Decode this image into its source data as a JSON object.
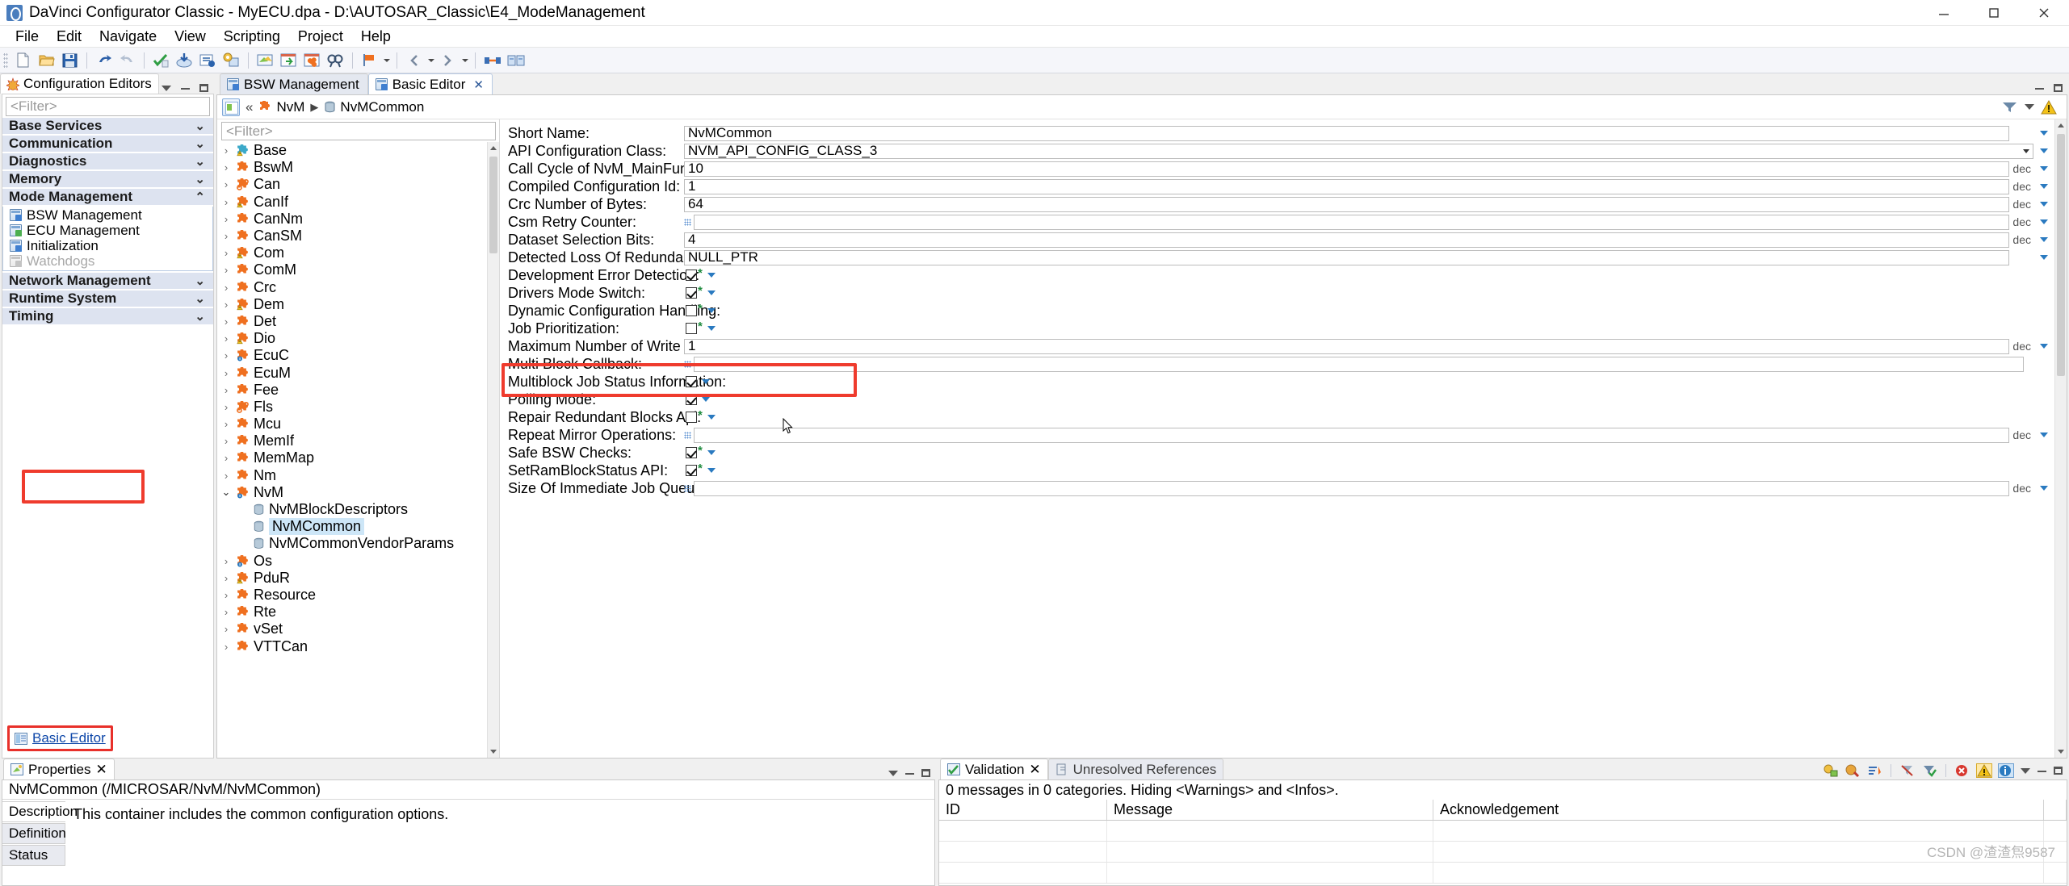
{
  "window": {
    "title": "DaVinci Configurator Classic - MyECU.dpa - D:\\AUTOSAR_Classic\\E4_ModeManagement",
    "app_icon": "davinci-icon",
    "minimize": "–",
    "maximize": "❑",
    "close": "✕"
  },
  "menubar": [
    "File",
    "Edit",
    "Navigate",
    "View",
    "Scripting",
    "Project",
    "Help"
  ],
  "toolbar": {
    "groups": [
      [
        "new-file-icon",
        "open-folder-icon",
        "save-icon"
      ],
      [
        "undo-icon",
        "redo-icon"
      ],
      [
        "validate-icon",
        "generate-icon",
        "report-icon",
        "settings-window-icon"
      ],
      [
        "editor-icon",
        "import-icon",
        "module-icon",
        "find-icon"
      ]
    ]
  },
  "left_panel": {
    "tab_label": "Configuration Editors",
    "tab_icon": "star-icon",
    "filter_placeholder": "<Filter>",
    "categories": [
      {
        "label": "Base Services",
        "expanded": false
      },
      {
        "label": "Communication",
        "expanded": false
      },
      {
        "label": "Diagnostics",
        "expanded": false
      },
      {
        "label": "Memory",
        "expanded": false
      },
      {
        "label": "Mode Management",
        "expanded": true,
        "items": [
          {
            "label": "BSW Management",
            "icon": "bsw-management-icon",
            "enabled": true
          },
          {
            "label": "ECU Management",
            "icon": "ecu-management-icon",
            "enabled": true
          },
          {
            "label": "Initialization",
            "icon": "initialization-icon",
            "enabled": true
          },
          {
            "label": "Watchdogs",
            "icon": "watchdogs-icon",
            "enabled": false
          }
        ]
      },
      {
        "label": "Network Management",
        "expanded": false
      },
      {
        "label": "Runtime System",
        "expanded": false
      },
      {
        "label": "Timing",
        "expanded": false
      }
    ],
    "basic_editor_link": "Basic Editor",
    "basic_editor_icon": "basic-editor-icon"
  },
  "editor": {
    "tabs": [
      {
        "label": "BSW Management",
        "icon": "bsw-management-icon",
        "active": false,
        "closable": false
      },
      {
        "label": "Basic Editor",
        "icon": "basic-editor-icon",
        "active": true,
        "closable": true,
        "close_glyph": "✕"
      }
    ],
    "breadcrumb": {
      "home_icon": "editor-home-icon",
      "back_glyph": "«",
      "items": [
        {
          "label": "NvM",
          "icon": "module-puzzle-icon"
        },
        {
          "label": "NvMCommon",
          "icon": "container-icon"
        }
      ],
      "separator": "▶",
      "filter_icon": "filter-icon",
      "warning_icon": "warning-icon",
      "dropdown_glyph": "▾"
    },
    "tree": {
      "filter_placeholder": "<Filter>",
      "nodes": [
        {
          "label": "Base",
          "icon": "module-warn-blue-icon",
          "state": "collapsed",
          "level": 0
        },
        {
          "label": "BswM",
          "icon": "module-puzzle-icon",
          "state": "collapsed",
          "level": 0
        },
        {
          "label": "Can",
          "icon": "module-ring-icon",
          "state": "collapsed",
          "level": 0
        },
        {
          "label": "CanIf",
          "icon": "module-warn-icon",
          "state": "collapsed",
          "level": 0
        },
        {
          "label": "CanNm",
          "icon": "module-puzzle-icon",
          "state": "collapsed",
          "level": 0
        },
        {
          "label": "CanSM",
          "icon": "module-puzzle-icon",
          "state": "collapsed",
          "level": 0
        },
        {
          "label": "Com",
          "icon": "module-warn-icon",
          "state": "collapsed",
          "level": 0
        },
        {
          "label": "ComM",
          "icon": "module-puzzle-icon",
          "state": "collapsed",
          "level": 0
        },
        {
          "label": "Crc",
          "icon": "module-puzzle-icon",
          "state": "collapsed",
          "level": 0
        },
        {
          "label": "Dem",
          "icon": "module-warn-icon",
          "state": "collapsed",
          "level": 0
        },
        {
          "label": "Det",
          "icon": "module-puzzle-icon",
          "state": "collapsed",
          "level": 0
        },
        {
          "label": "Dio",
          "icon": "module-warn-icon",
          "state": "collapsed",
          "level": 0
        },
        {
          "label": "EcuC",
          "icon": "module-info-icon",
          "state": "collapsed",
          "level": 0
        },
        {
          "label": "EcuM",
          "icon": "module-puzzle-icon",
          "state": "collapsed",
          "level": 0
        },
        {
          "label": "Fee",
          "icon": "module-puzzle-icon",
          "state": "collapsed",
          "level": 0
        },
        {
          "label": "Fls",
          "icon": "module-ring-icon",
          "state": "collapsed",
          "level": 0
        },
        {
          "label": "Mcu",
          "icon": "module-puzzle-icon",
          "state": "collapsed",
          "level": 0
        },
        {
          "label": "MemIf",
          "icon": "module-puzzle-icon",
          "state": "collapsed",
          "level": 0
        },
        {
          "label": "MemMap",
          "icon": "module-puzzle-icon",
          "state": "collapsed",
          "level": 0
        },
        {
          "label": "Nm",
          "icon": "module-puzzle-icon",
          "state": "collapsed",
          "level": 0
        },
        {
          "label": "NvM",
          "icon": "module-info-icon",
          "state": "expanded",
          "level": 0
        },
        {
          "label": "NvMBlockDescriptors",
          "icon": "container-icon",
          "state": "leaf",
          "level": 1
        },
        {
          "label": "NvMCommon",
          "icon": "container-icon",
          "state": "leaf",
          "level": 1,
          "selected": true
        },
        {
          "label": "NvMCommonVendorParams",
          "icon": "container-icon",
          "state": "leaf",
          "level": 1
        },
        {
          "label": "Os",
          "icon": "module-info-icon",
          "state": "collapsed",
          "level": 0
        },
        {
          "label": "PduR",
          "icon": "module-warn-icon",
          "state": "collapsed",
          "level": 0
        },
        {
          "label": "Resource",
          "icon": "module-puzzle-icon",
          "state": "collapsed",
          "level": 0
        },
        {
          "label": "Rte",
          "icon": "module-puzzle-icon",
          "state": "collapsed",
          "level": 0
        },
        {
          "label": "vSet",
          "icon": "module-puzzle-icon",
          "state": "collapsed",
          "level": 0
        },
        {
          "label": "VTTCan",
          "icon": "module-puzzle-icon",
          "state": "collapsed",
          "level": 0
        }
      ],
      "expand_glyph": "›",
      "collapse_glyph": "⌄"
    },
    "properties": [
      {
        "label": "Short Name:",
        "type": "text",
        "value": "NvMCommon",
        "unit": ""
      },
      {
        "label": "API Configuration Class:",
        "type": "combo",
        "value": "NVM_API_CONFIG_CLASS_3",
        "unit": ""
      },
      {
        "label": "Call Cycle of NvM_MainFunction [ms]:",
        "type": "text",
        "value": "10",
        "unit": "dec"
      },
      {
        "label": "Compiled Configuration Id:",
        "type": "text",
        "value": "1",
        "unit": "dec"
      },
      {
        "label": "Crc Number of Bytes:",
        "type": "text",
        "value": "64",
        "unit": "dec"
      },
      {
        "label": "Csm Retry Counter:",
        "type": "text",
        "value": "",
        "unit": "dec",
        "grip": true
      },
      {
        "label": "Dataset Selection Bits:",
        "type": "text",
        "value": "4",
        "unit": "dec"
      },
      {
        "label": "Detected Loss Of Redundancy Callback:",
        "type": "text",
        "value": "NULL_PTR",
        "unit": ""
      },
      {
        "label": "Development Error Detection:",
        "type": "checkbox",
        "checked": true,
        "star": true
      },
      {
        "label": "Drivers Mode Switch:",
        "type": "checkbox",
        "checked": true,
        "star": true
      },
      {
        "label": "Dynamic Configuration Handling:",
        "type": "checkbox",
        "checked": false,
        "star": true
      },
      {
        "label": "Job Prioritization:",
        "type": "checkbox",
        "checked": false,
        "star": true
      },
      {
        "label": "Maximum Number of Write Retries:",
        "type": "text",
        "value": "1",
        "unit": "dec"
      },
      {
        "label": "Multi Block Callback:",
        "type": "text",
        "value": "",
        "unit": "",
        "grip": true
      },
      {
        "label": "Multiblock Job Status Information:",
        "type": "checkbox",
        "checked": true,
        "star": false,
        "highlighted": true
      },
      {
        "label": "Polling Mode:",
        "type": "checkbox",
        "checked": true,
        "star": false
      },
      {
        "label": "Repair Redundant Blocks Api:",
        "type": "checkbox",
        "checked": false,
        "star": true
      },
      {
        "label": "Repeat Mirror Operations:",
        "type": "text",
        "value": "",
        "unit": "dec",
        "grip": true
      },
      {
        "label": "Safe BSW Checks:",
        "type": "checkbox",
        "checked": true,
        "star": true
      },
      {
        "label": "SetRamBlockStatus API:",
        "type": "checkbox",
        "checked": true,
        "star": true
      },
      {
        "label": "Size Of Immediate Job Queue:",
        "type": "text",
        "value": "",
        "unit": "dec",
        "grip": true
      }
    ]
  },
  "properties_panel": {
    "tab_label": "Properties",
    "tab_icon": "properties-icon",
    "close_glyph": "✕",
    "object_path": "NvMCommon (/MICROSAR/NvM/NvMCommon)",
    "tabs": [
      {
        "label": "Description",
        "active": true
      },
      {
        "label": "Definition",
        "active": false
      },
      {
        "label": "Status",
        "active": false
      }
    ],
    "description": "This container includes the common configuration options."
  },
  "validation_panel": {
    "tabs": [
      {
        "label": "Validation",
        "icon": "validation-icon",
        "active": true,
        "closable": true,
        "close_glyph": "✕"
      },
      {
        "label": "Unresolved References",
        "icon": "unresolved-icon",
        "active": false,
        "closable": false
      }
    ],
    "status_text": "0 messages in 0 categories. Hiding <Warnings> and <Infos>.",
    "columns": [
      "ID",
      "Message",
      "Acknowledgement"
    ],
    "rows": [],
    "toolbar_icons": [
      "solve-icon",
      "remove-icon",
      "sort-icon",
      "clear-filter-icon",
      "apply-filter-icon",
      "error-filter-icon",
      "warning-filter-icon",
      "info-filter-icon"
    ],
    "watermark": "CSDN @渣渣炰9587"
  },
  "colors": {
    "accent_blue": "#2a7ac0",
    "highlight_red": "#ef3b2d",
    "selection_blue": "#cde6f7",
    "category_bg": "#dde3f0",
    "module_orange": "#ef7020"
  }
}
